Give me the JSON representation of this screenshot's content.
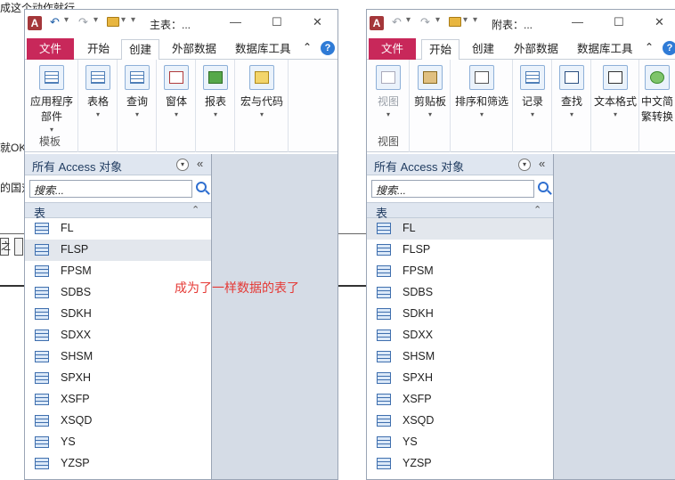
{
  "background": {
    "line1": "成这个动作就行",
    "line2": "就OK",
    "line3": "的国对",
    "box1": "之",
    "annotation": "成为了一样数据的表了"
  },
  "window1": {
    "title": "主表：...",
    "tabs": [
      "文件",
      "开始",
      "创建",
      "外部数据",
      "数据库工具"
    ],
    "active_tab": "创建",
    "ribbon": {
      "app_parts": "应用程序部件",
      "group_label": "模板",
      "buttons": [
        "表格",
        "查询",
        "窗体",
        "报表",
        "宏与代码"
      ]
    },
    "nav": {
      "title": "所有 Access 对象",
      "search_placeholder": "搜索...",
      "category": "表",
      "items": [
        "FL",
        "FLSP",
        "FPSM",
        "SDBS",
        "SDKH",
        "SDXX",
        "SHSM",
        "SPXH",
        "XSFP",
        "XSQD",
        "YS",
        "YZSP"
      ],
      "selected": "FLSP"
    }
  },
  "window2": {
    "title": "附表：...",
    "tabs": [
      "文件",
      "开始",
      "创建",
      "外部数据",
      "数据库工具"
    ],
    "active_tab": "开始",
    "ribbon": {
      "view": "视图",
      "group_label": "视图",
      "buttons": [
        "剪贴板",
        "排序和筛选",
        "记录",
        "查找",
        "文本格式",
        "中文简繁转换"
      ]
    },
    "nav": {
      "title": "所有 Access 对象",
      "search_placeholder": "搜索...",
      "category": "表",
      "items": [
        "FL",
        "FLSP",
        "FPSM",
        "SDBS",
        "SDKH",
        "SDXX",
        "SHSM",
        "SPXH",
        "XSFP",
        "XSQD",
        "YS",
        "YZSP"
      ],
      "selected": "FL"
    }
  },
  "colors": {
    "file_tab": "#c8285a",
    "annotation": "#e53935",
    "accent": "#2f7bd6"
  }
}
